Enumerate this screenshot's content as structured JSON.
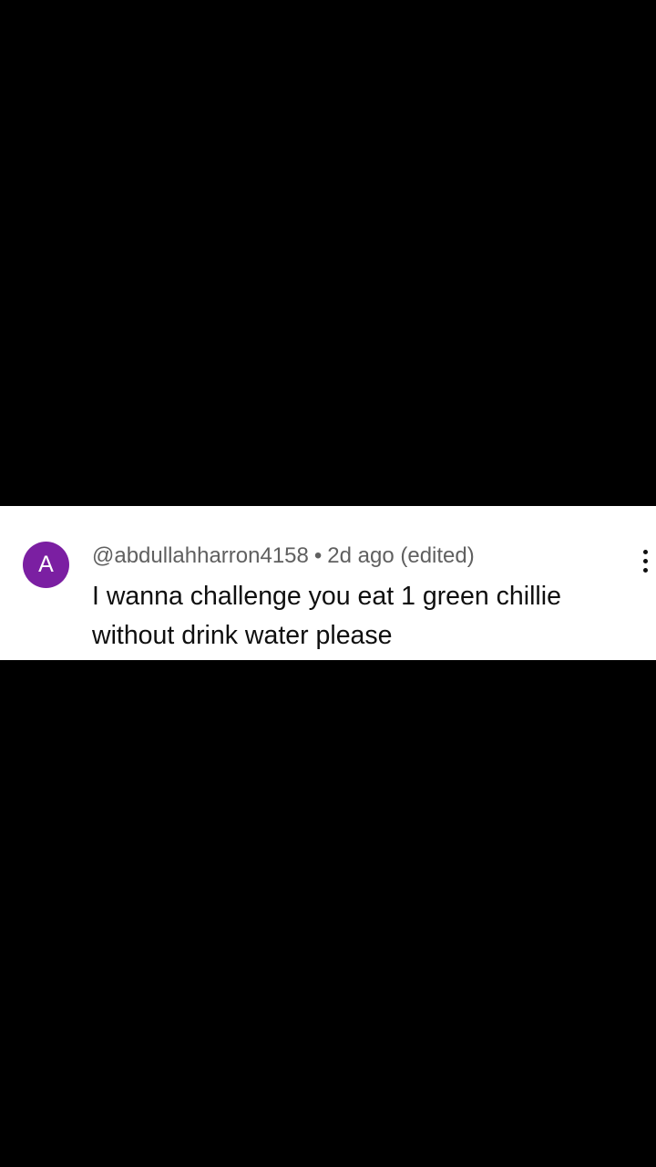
{
  "comment": {
    "avatar_letter": "A",
    "avatar_color": "#7b1fa2",
    "author": "@abdullahharron4158",
    "separator": "•",
    "timestamp": "2d ago (edited)",
    "text": "I wanna challenge you eat 1 green chillie without drink water please",
    "more_icon": "more-vertical-icon"
  },
  "colors": {
    "background": "#000000",
    "card": "#ffffff",
    "meta_text": "#606060",
    "body_text": "#0f0f0f"
  }
}
